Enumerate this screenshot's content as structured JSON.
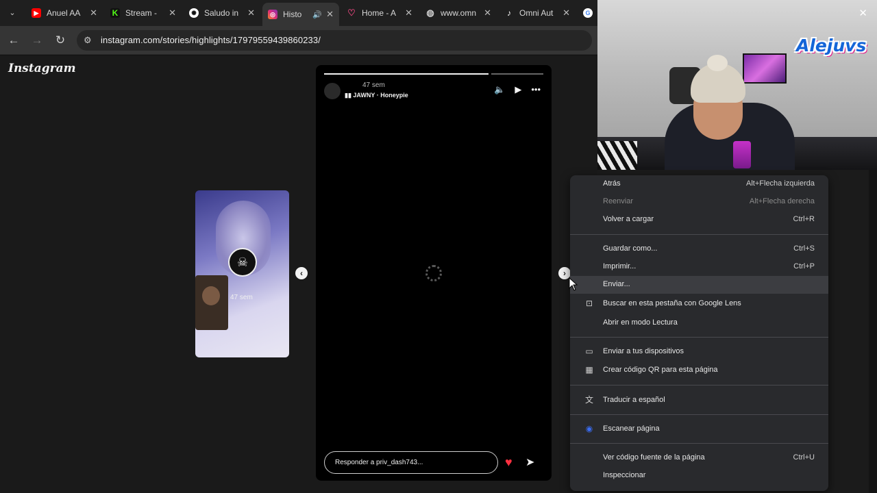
{
  "browser": {
    "tabs": [
      {
        "title": "Anuel AA",
        "favicon": "youtube-icon",
        "color": "#ff0000"
      },
      {
        "title": "Stream - ",
        "favicon": "kick-icon",
        "color": "#53fc18"
      },
      {
        "title": "Saludo in",
        "favicon": "openai-icon",
        "color": "#ffffff"
      },
      {
        "title": "Histo",
        "favicon": "instagram-icon",
        "color": "#e1306c",
        "active": true
      },
      {
        "title": "Home - A",
        "favicon": "heart-icon",
        "color": "#e0457b"
      },
      {
        "title": "www.omn",
        "favicon": "globe-icon",
        "color": "#cccccc"
      },
      {
        "title": "Omni Aut",
        "favicon": "tiktok-icon",
        "color": "#ffffff"
      }
    ],
    "url": "instagram.com/stories/highlights/17979559439860233/"
  },
  "instagram": {
    "logo": "Instagram",
    "prev_story_time": "47 sem",
    "story": {
      "time": "47 sem",
      "song": "JAWNY · Honeypie",
      "reply_placeholder": "Responder a priv_dash743..."
    }
  },
  "context_menu": {
    "items": [
      {
        "label": "Atrás",
        "shortcut": "Alt+Flecha izquierda",
        "enabled": true
      },
      {
        "label": "Reenviar",
        "shortcut": "Alt+Flecha derecha",
        "enabled": false
      },
      {
        "label": "Volver a cargar",
        "shortcut": "Ctrl+R",
        "enabled": true
      },
      {
        "label": "Guardar como...",
        "shortcut": "Ctrl+S",
        "enabled": true
      },
      {
        "label": "Imprimir...",
        "shortcut": "Ctrl+P",
        "enabled": true
      },
      {
        "label": "Enviar...",
        "shortcut": "",
        "enabled": true,
        "hover": true
      },
      {
        "label": "Buscar en esta pestaña con Google Lens",
        "shortcut": "",
        "icon": "lens-icon"
      },
      {
        "label": "Abrir en modo Lectura",
        "shortcut": ""
      },
      {
        "label": "Enviar a tus dispositivos",
        "shortcut": "",
        "icon": "devices-icon"
      },
      {
        "label": "Crear código QR para esta página",
        "shortcut": "",
        "icon": "qr-code-icon"
      },
      {
        "label": "Traducir a español",
        "shortcut": "",
        "icon": "translate-icon"
      },
      {
        "label": "Escanear página",
        "shortcut": "",
        "icon": "fingerprint-icon"
      },
      {
        "label": "Ver código fuente de la página",
        "shortcut": "Ctrl+U"
      },
      {
        "label": "Inspeccionar",
        "shortcut": ""
      }
    ]
  },
  "stream_overlay": {
    "logo_text": "Alejuvs"
  }
}
